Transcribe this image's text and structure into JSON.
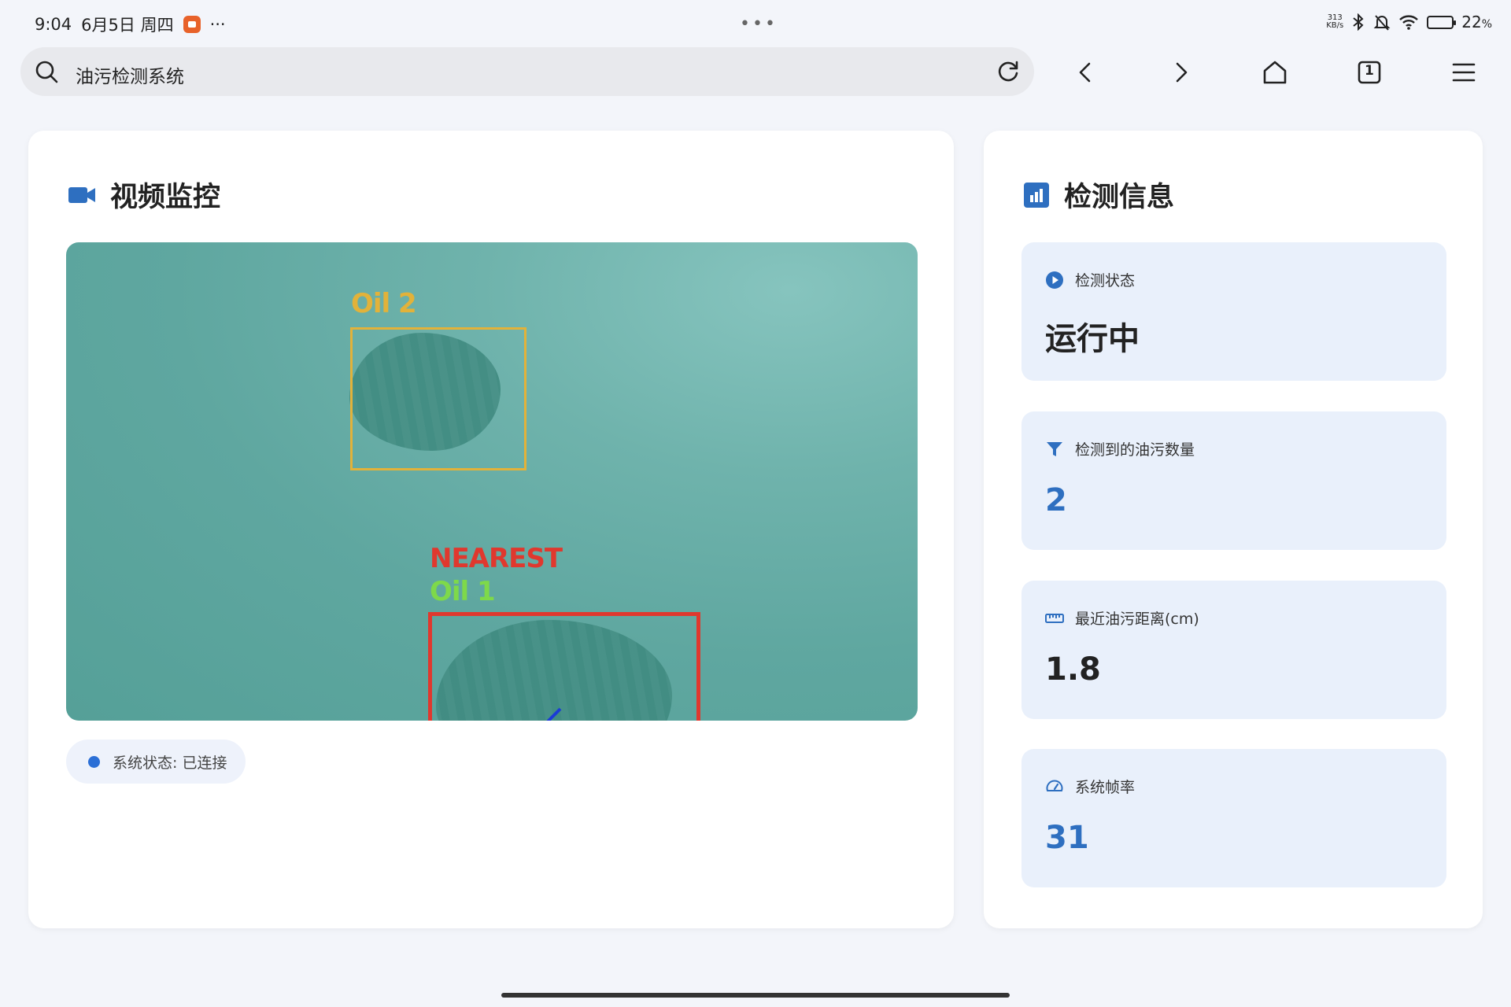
{
  "status_bar": {
    "time": "9:04",
    "date": "6月5日 周四",
    "app_more": "···",
    "center_dots": "•••",
    "net_speed_value": "313",
    "net_speed_unit": "KB/s",
    "battery_level": 22,
    "battery_text": "22",
    "battery_unit": "%"
  },
  "browser": {
    "url_text": "油污检测系统",
    "tab_count": "1"
  },
  "video_panel": {
    "title": "视频监控",
    "detections": [
      {
        "label": "Oil 2",
        "color": "#e2b23a"
      },
      {
        "nearest_label": "NEAREST",
        "label": "Oil 1",
        "color": "#e0382e",
        "label_color": "#7ed94a"
      }
    ],
    "system_status": "系统状态: 已连接"
  },
  "info_panel": {
    "title": "检测信息",
    "cards": [
      {
        "label": "检测状态",
        "value": "运行中",
        "icon": "play-circle-icon"
      },
      {
        "label": "检测到的油污数量",
        "value": "2",
        "icon": "filter-icon"
      },
      {
        "label": "最近油污距离(cm)",
        "value": "1.8",
        "icon": "ruler-icon"
      },
      {
        "label": "系统帧率",
        "value": "31",
        "icon": "gauge-icon"
      }
    ]
  },
  "colors": {
    "accent": "#2e6fc0",
    "card_bg": "#e9f0fb",
    "nearest_red": "#e0382e",
    "oil2_yellow": "#e2b23a",
    "oil1_green": "#7ed94a"
  }
}
